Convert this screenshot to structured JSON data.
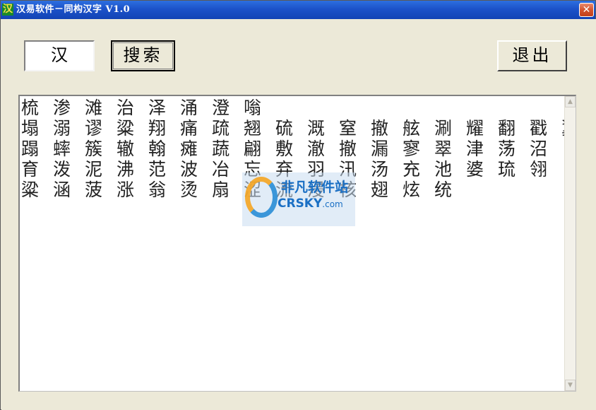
{
  "window": {
    "icon_glyph": "汉",
    "title": "汉易软件－同构汉字 V1.0",
    "close_glyph": "✕"
  },
  "search": {
    "input_value": "汉",
    "search_label": "搜索",
    "exit_label": "退出"
  },
  "results": {
    "lines": [
      [
        "梳",
        "渗",
        "滩",
        "治",
        "泽",
        "涌",
        "澄",
        "嗡"
      ],
      [
        "塌",
        "溺",
        "谬",
        "粱",
        "翔",
        "痛",
        "疏",
        "翘",
        "硫",
        "溉",
        "窒",
        "撤",
        "舷",
        "涮",
        "耀",
        "翻",
        "戳",
        "翼"
      ],
      [
        "蹋",
        "蟀",
        "簇",
        "辙",
        "翰",
        "瘫",
        "蔬",
        "翩",
        "敷",
        "澈",
        "撤",
        "漏",
        "寥",
        "翠",
        "津",
        "荡",
        "沼"
      ],
      [
        "育",
        "泼",
        "泥",
        "沸",
        "范",
        "波",
        "冶",
        "忘",
        "弃",
        "羽",
        "汛",
        "汤",
        "充",
        "池",
        "婆",
        "琉",
        "翎"
      ],
      [
        "粱",
        "涵",
        "菠",
        "涨",
        "翁",
        "烫",
        "扇",
        "涩",
        "流",
        "浸",
        "核",
        "翅",
        "炫",
        "统"
      ]
    ]
  },
  "scrollbar": {
    "up_glyph": "▲",
    "down_glyph": "▼"
  },
  "watermark": {
    "cn_text": "非凡软件站",
    "en_text": "CRSKY",
    "en_suffix": ".com"
  },
  "colors": {
    "titlebar": "#1c52c9",
    "client_bg": "#ece9d8",
    "close_button": "#d4542e",
    "watermark_text": "#1a6fc4"
  }
}
